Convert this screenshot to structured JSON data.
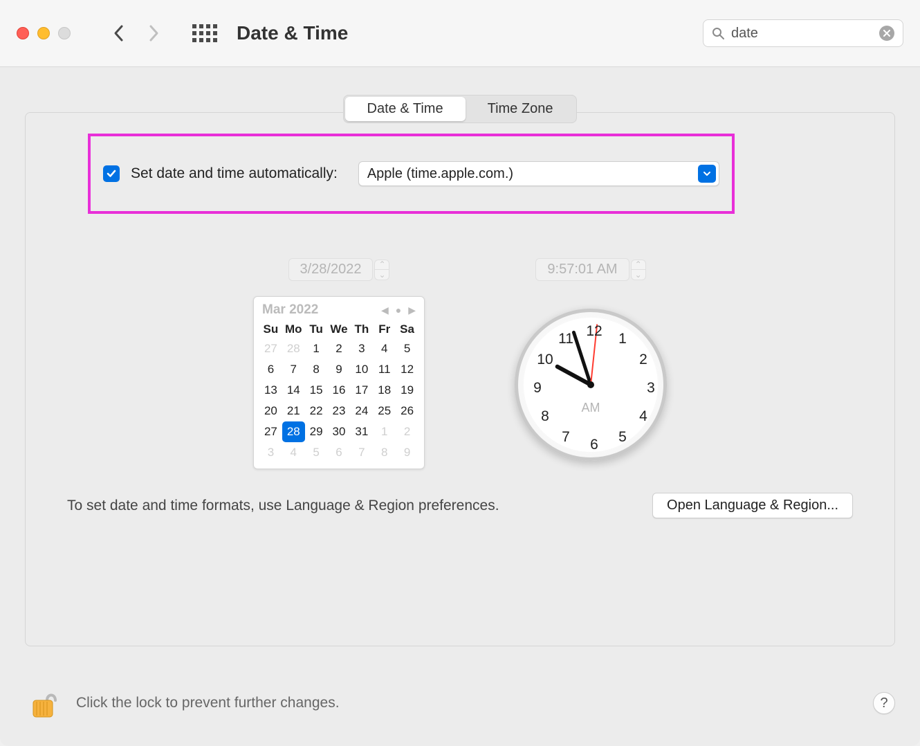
{
  "window": {
    "title": "Date & Time"
  },
  "toolbar": {
    "search_value": "date"
  },
  "tabs": {
    "date_time": "Date & Time",
    "time_zone": "Time Zone",
    "active": "date_time"
  },
  "auto": {
    "checked": true,
    "label": "Set date and time automatically:",
    "server": "Apple (time.apple.com.)"
  },
  "date_field": "3/28/2022",
  "time_field": "9:57:01 AM",
  "calendar": {
    "title": "Mar 2022",
    "dow": [
      "Su",
      "Mo",
      "Tu",
      "We",
      "Th",
      "Fr",
      "Sa"
    ],
    "cells": [
      {
        "n": "27",
        "dim": true
      },
      {
        "n": "28",
        "dim": true
      },
      {
        "n": "1"
      },
      {
        "n": "2"
      },
      {
        "n": "3"
      },
      {
        "n": "4"
      },
      {
        "n": "5"
      },
      {
        "n": "6"
      },
      {
        "n": "7"
      },
      {
        "n": "8"
      },
      {
        "n": "9"
      },
      {
        "n": "10"
      },
      {
        "n": "11"
      },
      {
        "n": "12"
      },
      {
        "n": "13"
      },
      {
        "n": "14"
      },
      {
        "n": "15"
      },
      {
        "n": "16"
      },
      {
        "n": "17"
      },
      {
        "n": "18"
      },
      {
        "n": "19"
      },
      {
        "n": "20"
      },
      {
        "n": "21"
      },
      {
        "n": "22"
      },
      {
        "n": "23"
      },
      {
        "n": "24"
      },
      {
        "n": "25"
      },
      {
        "n": "26"
      },
      {
        "n": "27"
      },
      {
        "n": "28",
        "sel": true
      },
      {
        "n": "29"
      },
      {
        "n": "30"
      },
      {
        "n": "31"
      },
      {
        "n": "1",
        "dim": true
      },
      {
        "n": "2",
        "dim": true
      },
      {
        "n": "3",
        "dim": true
      },
      {
        "n": "4",
        "dim": true
      },
      {
        "n": "5",
        "dim": true
      },
      {
        "n": "6",
        "dim": true
      },
      {
        "n": "7",
        "dim": true
      },
      {
        "n": "8",
        "dim": true
      },
      {
        "n": "9",
        "dim": true
      }
    ]
  },
  "clock": {
    "label": "AM",
    "hour_angle": 298.5,
    "minute_angle": 342,
    "second_angle": 6,
    "numbers": [
      "12",
      "1",
      "2",
      "3",
      "4",
      "5",
      "6",
      "7",
      "8",
      "9",
      "10",
      "11"
    ]
  },
  "footer": {
    "hint": "To set date and time formats, use Language & Region preferences.",
    "button": "Open Language & Region..."
  },
  "lock": {
    "text": "Click the lock to prevent further changes."
  },
  "help_label": "?"
}
